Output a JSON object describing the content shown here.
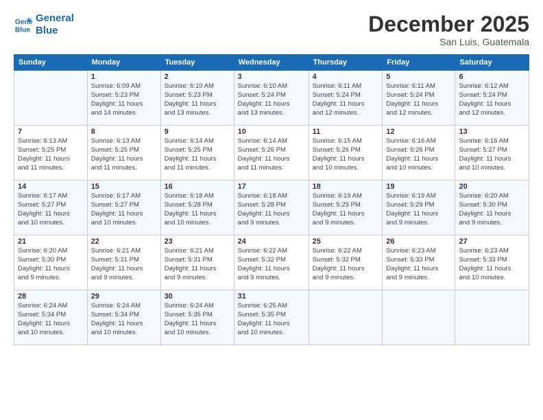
{
  "logo": {
    "line1": "General",
    "line2": "Blue"
  },
  "title": "December 2025",
  "location": "San Luis, Guatemala",
  "weekdays": [
    "Sunday",
    "Monday",
    "Tuesday",
    "Wednesday",
    "Thursday",
    "Friday",
    "Saturday"
  ],
  "weeks": [
    [
      {
        "day": "",
        "sunrise": "",
        "sunset": "",
        "daylight": ""
      },
      {
        "day": "1",
        "sunrise": "Sunrise: 6:09 AM",
        "sunset": "Sunset: 5:23 PM",
        "daylight": "Daylight: 11 hours and 14 minutes."
      },
      {
        "day": "2",
        "sunrise": "Sunrise: 6:10 AM",
        "sunset": "Sunset: 5:23 PM",
        "daylight": "Daylight: 11 hours and 13 minutes."
      },
      {
        "day": "3",
        "sunrise": "Sunrise: 6:10 AM",
        "sunset": "Sunset: 5:24 PM",
        "daylight": "Daylight: 11 hours and 13 minutes."
      },
      {
        "day": "4",
        "sunrise": "Sunrise: 6:11 AM",
        "sunset": "Sunset: 5:24 PM",
        "daylight": "Daylight: 11 hours and 12 minutes."
      },
      {
        "day": "5",
        "sunrise": "Sunrise: 6:11 AM",
        "sunset": "Sunset: 5:24 PM",
        "daylight": "Daylight: 11 hours and 12 minutes."
      },
      {
        "day": "6",
        "sunrise": "Sunrise: 6:12 AM",
        "sunset": "Sunset: 5:24 PM",
        "daylight": "Daylight: 11 hours and 12 minutes."
      }
    ],
    [
      {
        "day": "7",
        "sunrise": "Sunrise: 6:13 AM",
        "sunset": "Sunset: 5:25 PM",
        "daylight": "Daylight: 11 hours and 11 minutes."
      },
      {
        "day": "8",
        "sunrise": "Sunrise: 6:13 AM",
        "sunset": "Sunset: 5:25 PM",
        "daylight": "Daylight: 11 hours and 11 minutes."
      },
      {
        "day": "9",
        "sunrise": "Sunrise: 6:14 AM",
        "sunset": "Sunset: 5:25 PM",
        "daylight": "Daylight: 11 hours and 11 minutes."
      },
      {
        "day": "10",
        "sunrise": "Sunrise: 6:14 AM",
        "sunset": "Sunset: 5:26 PM",
        "daylight": "Daylight: 11 hours and 11 minutes."
      },
      {
        "day": "11",
        "sunrise": "Sunrise: 6:15 AM",
        "sunset": "Sunset: 5:26 PM",
        "daylight": "Daylight: 11 hours and 10 minutes."
      },
      {
        "day": "12",
        "sunrise": "Sunrise: 6:16 AM",
        "sunset": "Sunset: 5:26 PM",
        "daylight": "Daylight: 11 hours and 10 minutes."
      },
      {
        "day": "13",
        "sunrise": "Sunrise: 6:16 AM",
        "sunset": "Sunset: 5:27 PM",
        "daylight": "Daylight: 11 hours and 10 minutes."
      }
    ],
    [
      {
        "day": "14",
        "sunrise": "Sunrise: 6:17 AM",
        "sunset": "Sunset: 5:27 PM",
        "daylight": "Daylight: 11 hours and 10 minutes."
      },
      {
        "day": "15",
        "sunrise": "Sunrise: 6:17 AM",
        "sunset": "Sunset: 5:27 PM",
        "daylight": "Daylight: 11 hours and 10 minutes."
      },
      {
        "day": "16",
        "sunrise": "Sunrise: 6:18 AM",
        "sunset": "Sunset: 5:28 PM",
        "daylight": "Daylight: 11 hours and 10 minutes."
      },
      {
        "day": "17",
        "sunrise": "Sunrise: 6:18 AM",
        "sunset": "Sunset: 5:28 PM",
        "daylight": "Daylight: 11 hours and 9 minutes."
      },
      {
        "day": "18",
        "sunrise": "Sunrise: 6:19 AM",
        "sunset": "Sunset: 5:29 PM",
        "daylight": "Daylight: 11 hours and 9 minutes."
      },
      {
        "day": "19",
        "sunrise": "Sunrise: 6:19 AM",
        "sunset": "Sunset: 5:29 PM",
        "daylight": "Daylight: 11 hours and 9 minutes."
      },
      {
        "day": "20",
        "sunrise": "Sunrise: 6:20 AM",
        "sunset": "Sunset: 5:30 PM",
        "daylight": "Daylight: 11 hours and 9 minutes."
      }
    ],
    [
      {
        "day": "21",
        "sunrise": "Sunrise: 6:20 AM",
        "sunset": "Sunset: 5:30 PM",
        "daylight": "Daylight: 11 hours and 9 minutes."
      },
      {
        "day": "22",
        "sunrise": "Sunrise: 6:21 AM",
        "sunset": "Sunset: 5:31 PM",
        "daylight": "Daylight: 11 hours and 9 minutes."
      },
      {
        "day": "23",
        "sunrise": "Sunrise: 6:21 AM",
        "sunset": "Sunset: 5:31 PM",
        "daylight": "Daylight: 11 hours and 9 minutes."
      },
      {
        "day": "24",
        "sunrise": "Sunrise: 6:22 AM",
        "sunset": "Sunset: 5:32 PM",
        "daylight": "Daylight: 11 hours and 9 minutes."
      },
      {
        "day": "25",
        "sunrise": "Sunrise: 6:22 AM",
        "sunset": "Sunset: 5:32 PM",
        "daylight": "Daylight: 11 hours and 9 minutes."
      },
      {
        "day": "26",
        "sunrise": "Sunrise: 6:23 AM",
        "sunset": "Sunset: 5:33 PM",
        "daylight": "Daylight: 11 hours and 9 minutes."
      },
      {
        "day": "27",
        "sunrise": "Sunrise: 6:23 AM",
        "sunset": "Sunset: 5:33 PM",
        "daylight": "Daylight: 11 hours and 10 minutes."
      }
    ],
    [
      {
        "day": "28",
        "sunrise": "Sunrise: 6:24 AM",
        "sunset": "Sunset: 5:34 PM",
        "daylight": "Daylight: 11 hours and 10 minutes."
      },
      {
        "day": "29",
        "sunrise": "Sunrise: 6:24 AM",
        "sunset": "Sunset: 5:34 PM",
        "daylight": "Daylight: 11 hours and 10 minutes."
      },
      {
        "day": "30",
        "sunrise": "Sunrise: 6:24 AM",
        "sunset": "Sunset: 5:35 PM",
        "daylight": "Daylight: 11 hours and 10 minutes."
      },
      {
        "day": "31",
        "sunrise": "Sunrise: 6:25 AM",
        "sunset": "Sunset: 5:35 PM",
        "daylight": "Daylight: 11 hours and 10 minutes."
      },
      {
        "day": "",
        "sunrise": "",
        "sunset": "",
        "daylight": ""
      },
      {
        "day": "",
        "sunrise": "",
        "sunset": "",
        "daylight": ""
      },
      {
        "day": "",
        "sunrise": "",
        "sunset": "",
        "daylight": ""
      }
    ]
  ],
  "stripe_rows": [
    0,
    2,
    4
  ]
}
